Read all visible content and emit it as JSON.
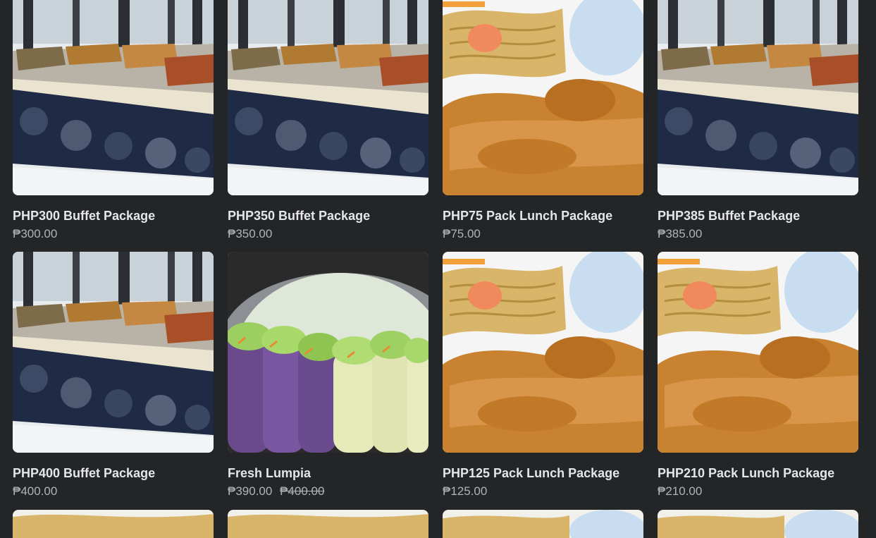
{
  "products": [
    {
      "title": "PHP300 Buffet Package",
      "price": "₱300.00",
      "image": "buffet"
    },
    {
      "title": "PHP350 Buffet Package",
      "price": "₱350.00",
      "image": "buffet"
    },
    {
      "title": "PHP75 Pack Lunch Package",
      "price": "₱75.00",
      "image": "lunch"
    },
    {
      "title": "PHP385 Buffet Package",
      "price": "₱385.00",
      "image": "buffet"
    },
    {
      "title": "PHP400 Buffet Package",
      "price": "₱400.00",
      "image": "buffet"
    },
    {
      "title": "Fresh Lumpia",
      "price": "₱390.00",
      "old_price": "₱400.00",
      "image": "lumpia"
    },
    {
      "title": "PHP125 Pack Lunch Package",
      "price": "₱125.00",
      "image": "lunch"
    },
    {
      "title": "PHP210 Pack Lunch Package",
      "price": "₱210.00",
      "image": "lunch"
    }
  ]
}
